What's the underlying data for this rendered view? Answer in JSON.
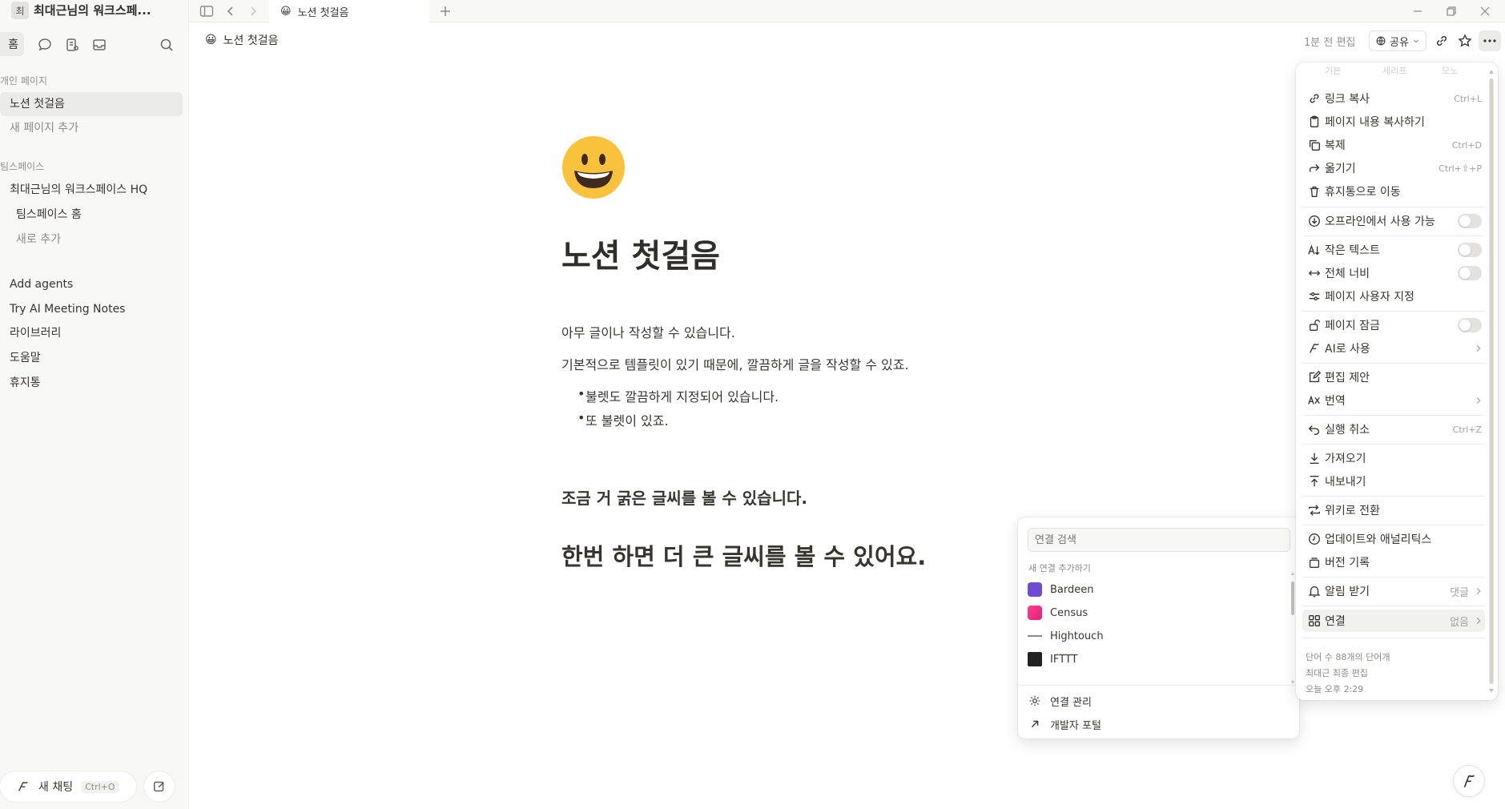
{
  "sidebar": {
    "workspace_badge": "최",
    "workspace_name": "최대근님의 워크스페...",
    "home_label": "홈",
    "section_private": "개인 페이지",
    "pages": [
      "노션 첫걸음",
      "새 페이지 추가"
    ],
    "section_teamspace": "팀스페이스",
    "teamspace_items": [
      "최대근님의 워크스페이스 HQ",
      "팀스페이스 홈",
      "새로 추가"
    ],
    "misc_items": [
      "Add agents",
      "Try AI Meeting Notes",
      "라이브러리",
      "도움말",
      "휴지통"
    ],
    "new_chat": "새 채팅",
    "new_chat_shortcut": "Ctrl+O"
  },
  "tab": {
    "emoji": "😀",
    "title": "노션 첫걸음"
  },
  "header": {
    "breadcrumb": "노션 첫걸음",
    "edited": "1분 전 편집",
    "share": "공유"
  },
  "page": {
    "title": "노션 첫걸음",
    "para1": "아무 글이나 작성할 수 있습니다.",
    "para2": "기본적으로 템플릿이 있기 때문에, 깔끔하게 글을 작성할 수 있죠.",
    "bullets": [
      "불렛도 깔끔하게 지정되어 있습니다.",
      "또 불렛이 있죠."
    ],
    "heading3": "조금 거 굵은 글씨를 볼 수 있습니다.",
    "heading2": "한번 하면 더 큰 글씨를 볼 수 있어요."
  },
  "connections": {
    "search_placeholder": "연결 검색",
    "section": "새 연결 추가하기",
    "items": [
      "Bardeen",
      "Census",
      "Hightouch",
      "IFTTT"
    ],
    "footer": [
      "연결 관리",
      "개발자 포털"
    ]
  },
  "menu": {
    "tabs": [
      "기본",
      "세리프",
      "모노"
    ],
    "items": {
      "copy_link": {
        "label": "링크 복사",
        "shortcut": "Ctrl+L"
      },
      "copy_content": {
        "label": "페이지 내용 복사하기"
      },
      "duplicate": {
        "label": "복제",
        "shortcut": "Ctrl+D"
      },
      "move": {
        "label": "옮기기",
        "shortcut": "Ctrl+⇧+P"
      },
      "trash": {
        "label": "휴지통으로 이동"
      },
      "offline": {
        "label": "오프라인에서 사용 가능"
      },
      "small_text": {
        "label": "작은 텍스트"
      },
      "full_width": {
        "label": "전체 너비"
      },
      "customize": {
        "label": "페이지 사용자 지정"
      },
      "lock": {
        "label": "페이지 잠금"
      },
      "ai": {
        "label": "AI로 사용"
      },
      "suggest": {
        "label": "편집 제안"
      },
      "translate": {
        "label": "번역"
      },
      "undo": {
        "label": "실행 취소",
        "shortcut": "Ctrl+Z"
      },
      "import": {
        "label": "가져오기"
      },
      "export": {
        "label": "내보내기"
      },
      "wiki": {
        "label": "위키로 전환"
      },
      "analytics": {
        "label": "업데이트와 애널리틱스"
      },
      "history": {
        "label": "버전 기록"
      },
      "notify": {
        "label": "알림 받기",
        "value": "댓글"
      },
      "connect": {
        "label": "연결",
        "value": "없음"
      }
    },
    "footer": {
      "words": "단어 수 88개의 단어개",
      "edited_by": "최대근 최종 편집",
      "time": "오늘 오후 2:29"
    }
  }
}
